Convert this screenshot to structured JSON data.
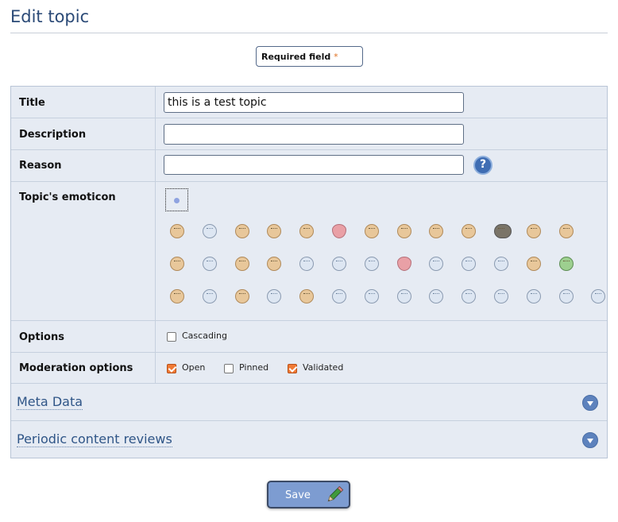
{
  "page": {
    "title": "Edit topic"
  },
  "required_note": {
    "label": "Required field",
    "star": "*"
  },
  "fields": {
    "title": {
      "label": "Title",
      "value": "this is a test topic"
    },
    "description": {
      "label": "Description",
      "value": ""
    },
    "reason": {
      "label": "Reason",
      "value": "",
      "help_icon": "question-icon",
      "help_text": "?"
    },
    "emoticon": {
      "label": "Topic's emoticon",
      "selected_icon": "none-selected-icon",
      "icon_count": 40
    },
    "options": {
      "label": "Options",
      "items": [
        {
          "label": "Cascading",
          "checked": false
        }
      ]
    },
    "moderation": {
      "label": "Moderation options",
      "items": [
        {
          "label": "Open",
          "checked": true
        },
        {
          "label": "Pinned",
          "checked": false
        },
        {
          "label": "Validated",
          "checked": true
        }
      ]
    }
  },
  "sections": [
    {
      "title": "Meta Data",
      "icon": "chevron-down-icon"
    },
    {
      "title": "Periodic content reviews",
      "icon": "chevron-down-icon"
    }
  ],
  "save_button": {
    "label": "Save",
    "icon": "pencil-icon"
  },
  "colors": {
    "title": "#2b4a77",
    "form_bg": "#e6ebf3",
    "accent": "#5d82bd",
    "checkbox_checked": "#f07a35",
    "required_star": "#e07020"
  }
}
